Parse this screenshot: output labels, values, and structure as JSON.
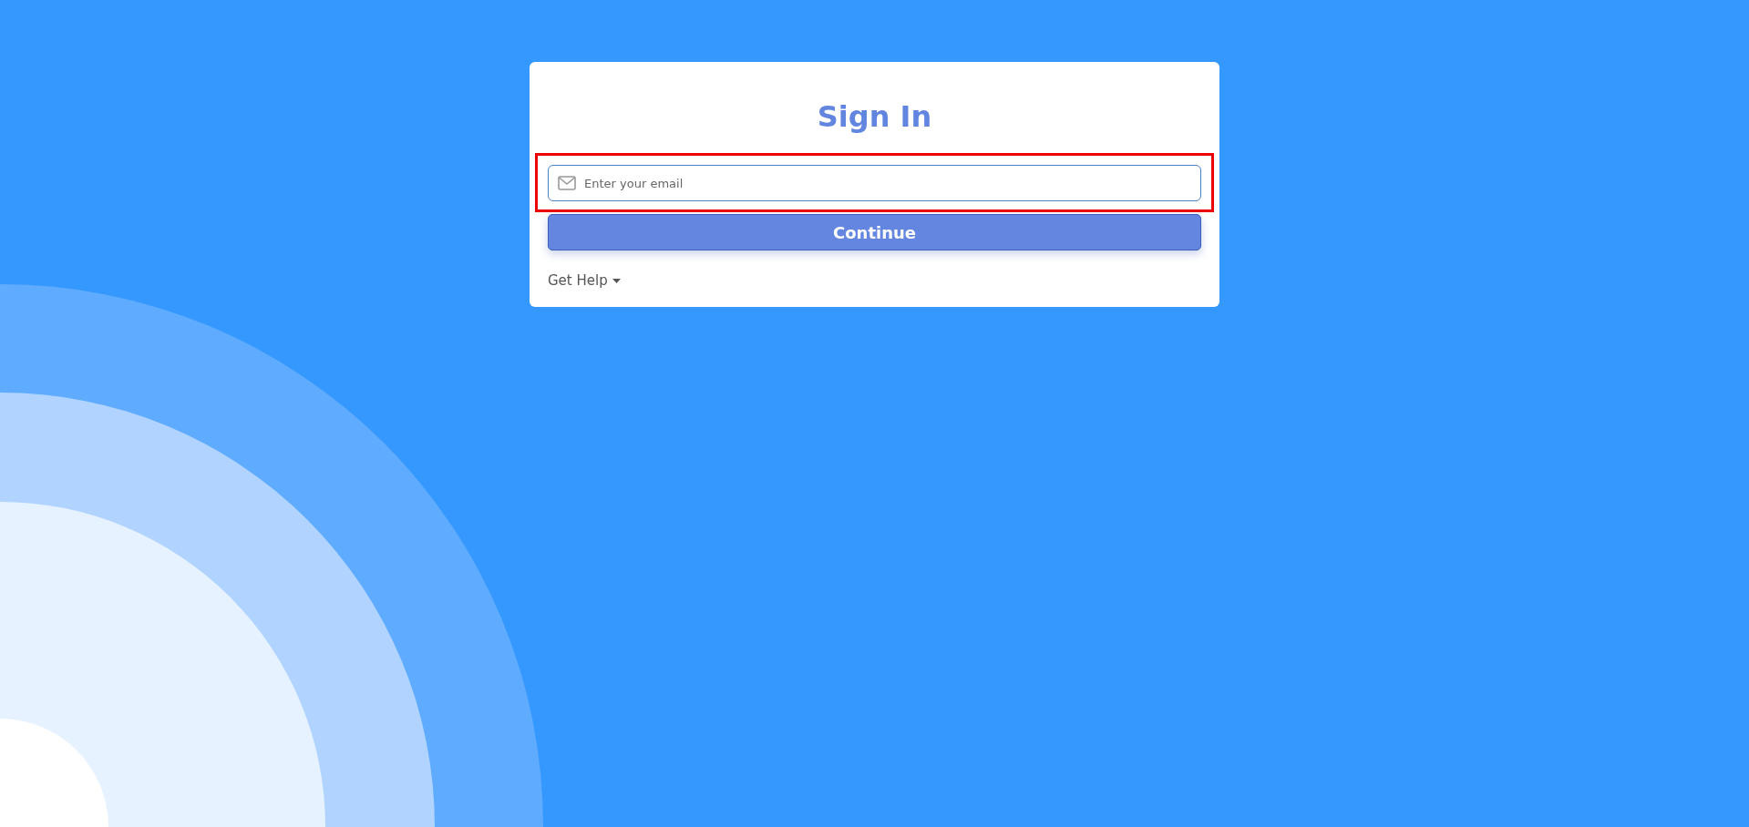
{
  "title": "Sign In",
  "email_field": {
    "placeholder": "Enter your email",
    "highlighted": true
  },
  "continue_button": {
    "label": "Continue"
  },
  "help_menu": {
    "label": "Get Help",
    "expanded": false
  }
}
